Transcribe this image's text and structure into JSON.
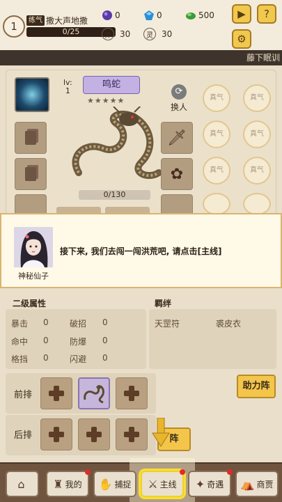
{
  "player": {
    "level": "1",
    "tag": "练气",
    "name": "撒大声地撒",
    "exp": "0/25"
  },
  "resources": {
    "purple": "0",
    "blue": "0",
    "green": "500",
    "stat_a_seal": "体",
    "stat_a": "30",
    "stat_b_seal": "灵",
    "stat_b": "30"
  },
  "ticker": "藤下眠训",
  "character": {
    "lv_label": "lv:",
    "lv_value": "1",
    "name": "鸣蛇",
    "stars": "★★★★★",
    "hp": "0/130",
    "swap_label": "换人",
    "qi_label": "真气"
  },
  "dialog": {
    "npc_name": "神秘仙子",
    "text": "接下来, 我们去闯一闯洪荒吧, 请点击[主线]"
  },
  "attributes": {
    "title": "二级属性",
    "items": [
      {
        "label": "暴击",
        "value": "0"
      },
      {
        "label": "破招",
        "value": "0"
      },
      {
        "label": "命中",
        "value": "0"
      },
      {
        "label": "防爆",
        "value": "0"
      },
      {
        "label": "格挡",
        "value": "0"
      },
      {
        "label": "闪避",
        "value": "0"
      }
    ]
  },
  "bonds": {
    "title": "羁绊",
    "items": [
      "天罡符",
      "裘皮衣"
    ]
  },
  "formation": {
    "front_label": "前排",
    "back_label": "后排",
    "assist_label": "助力阵",
    "array_label": "阵"
  },
  "nav": {
    "items": [
      {
        "label": "",
        "icon": "home-icon"
      },
      {
        "label": "我的",
        "icon": "bag-icon"
      },
      {
        "label": "捕捉",
        "icon": "capture-icon"
      },
      {
        "label": "主线",
        "icon": "swords-icon"
      },
      {
        "label": "奇遇",
        "icon": "encounter-icon"
      },
      {
        "label": "商贾",
        "icon": "shop-icon"
      }
    ]
  },
  "colors": {
    "accent_gold": "#f3c64b",
    "name_plate": "#c4b1e4",
    "highlight": "#f7df3a"
  }
}
